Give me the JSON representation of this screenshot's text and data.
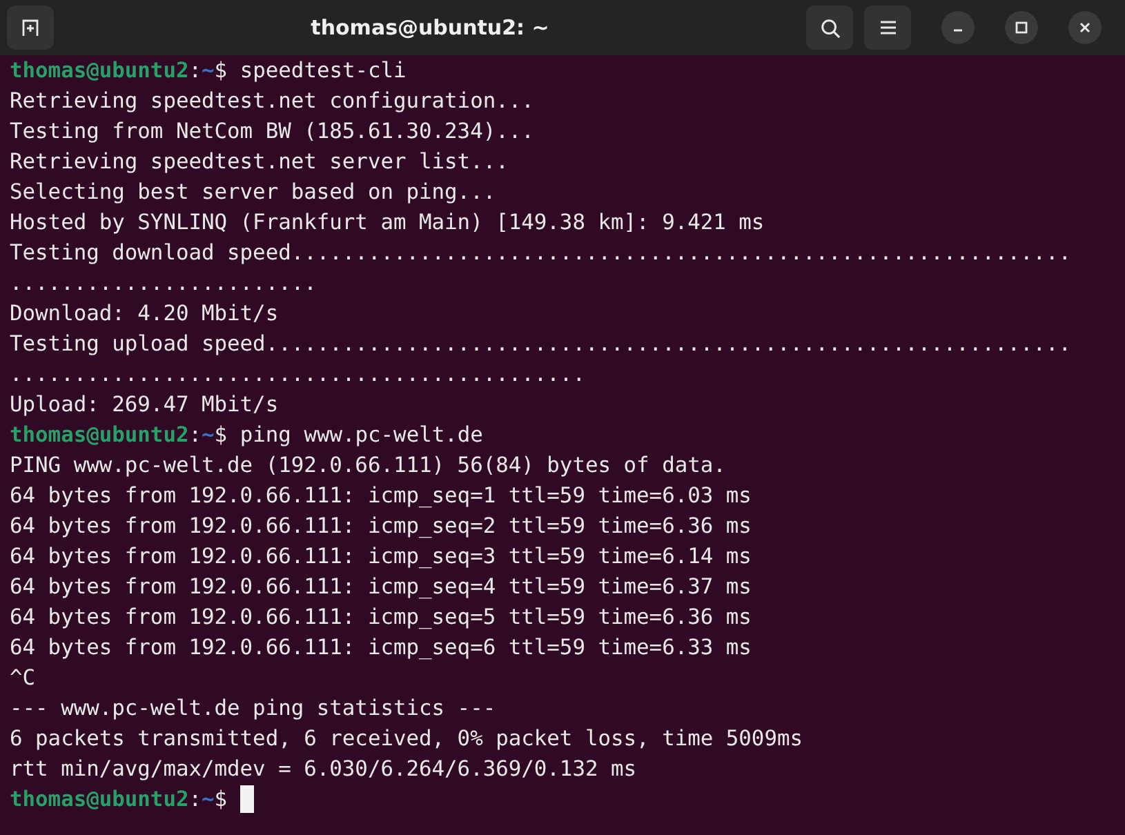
{
  "window": {
    "title": "thomas@ubuntu2: ~"
  },
  "terminal": {
    "lines": [
      {
        "kind": "prompt",
        "user": "thomas@ubuntu2",
        "separator": ":",
        "path": "~",
        "symbol": "$",
        "command": "speedtest-cli",
        "cursor": false
      },
      {
        "kind": "output",
        "text": "Retrieving speedtest.net configuration..."
      },
      {
        "kind": "output",
        "text": "Testing from NetCom BW (185.61.30.234)..."
      },
      {
        "kind": "output",
        "text": "Retrieving speedtest.net server list..."
      },
      {
        "kind": "output",
        "text": "Selecting best server based on ping..."
      },
      {
        "kind": "output",
        "text": "Hosted by SYNLINQ (Frankfurt am Main) [149.38 km]: 9.421 ms"
      },
      {
        "kind": "output",
        "text": "Testing download speed............................................................."
      },
      {
        "kind": "output",
        "text": "........................"
      },
      {
        "kind": "output",
        "text": "Download: 4.20 Mbit/s"
      },
      {
        "kind": "output",
        "text": "Testing upload speed..............................................................."
      },
      {
        "kind": "output",
        "text": "............................................."
      },
      {
        "kind": "output",
        "text": "Upload: 269.47 Mbit/s"
      },
      {
        "kind": "prompt",
        "user": "thomas@ubuntu2",
        "separator": ":",
        "path": "~",
        "symbol": "$",
        "command": "ping www.pc-welt.de",
        "cursor": false
      },
      {
        "kind": "output",
        "text": "PING www.pc-welt.de (192.0.66.111) 56(84) bytes of data."
      },
      {
        "kind": "output",
        "text": "64 bytes from 192.0.66.111: icmp_seq=1 ttl=59 time=6.03 ms"
      },
      {
        "kind": "output",
        "text": "64 bytes from 192.0.66.111: icmp_seq=2 ttl=59 time=6.36 ms"
      },
      {
        "kind": "output",
        "text": "64 bytes from 192.0.66.111: icmp_seq=3 ttl=59 time=6.14 ms"
      },
      {
        "kind": "output",
        "text": "64 bytes from 192.0.66.111: icmp_seq=4 ttl=59 time=6.37 ms"
      },
      {
        "kind": "output",
        "text": "64 bytes from 192.0.66.111: icmp_seq=5 ttl=59 time=6.36 ms"
      },
      {
        "kind": "output",
        "text": "64 bytes from 192.0.66.111: icmp_seq=6 ttl=59 time=6.33 ms"
      },
      {
        "kind": "output",
        "text": "^C"
      },
      {
        "kind": "output",
        "text": "--- www.pc-welt.de ping statistics ---"
      },
      {
        "kind": "output",
        "text": "6 packets transmitted, 6 received, 0% packet loss, time 5009ms"
      },
      {
        "kind": "output",
        "text": "rtt min/avg/max/mdev = 6.030/6.264/6.369/0.132 ms"
      },
      {
        "kind": "prompt",
        "user": "thomas@ubuntu2",
        "separator": ":",
        "path": "~",
        "symbol": "$",
        "cursor": true
      }
    ]
  }
}
